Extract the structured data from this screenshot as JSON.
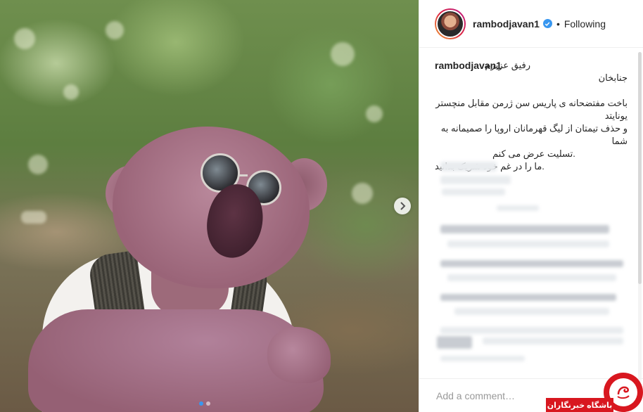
{
  "post": {
    "image_alt": "",
    "carousel_dots": 2,
    "active_dot": 0
  },
  "header": {
    "username": "rambodjavan1",
    "separator": "•",
    "follow_status": "Following"
  },
  "caption": {
    "username": "rambodjavan1",
    "line1": "رفیق عزیزم",
    "line2": "جنابخان",
    "body": [
      "باخت مفتضحانه ی پاریس سن ژرمن مقابل منچستر یونایتد",
      "و حذف تیمتان از لیگ قهرمانان اروپا را صمیمانه به شما",
      ".تسلیت عرض می کنم",
      ".ما را در غم خود شریک بدانید"
    ]
  },
  "comment": {
    "placeholder": "Add a comment…"
  },
  "watermark": {
    "text": "باشگاه خبرنگاران"
  },
  "colors": {
    "accent": "#3897f0",
    "brand_red": "#d8171f",
    "text": "#262626"
  },
  "icons": {
    "next": "chevron-right-icon",
    "verified": "verified-badge-icon"
  }
}
